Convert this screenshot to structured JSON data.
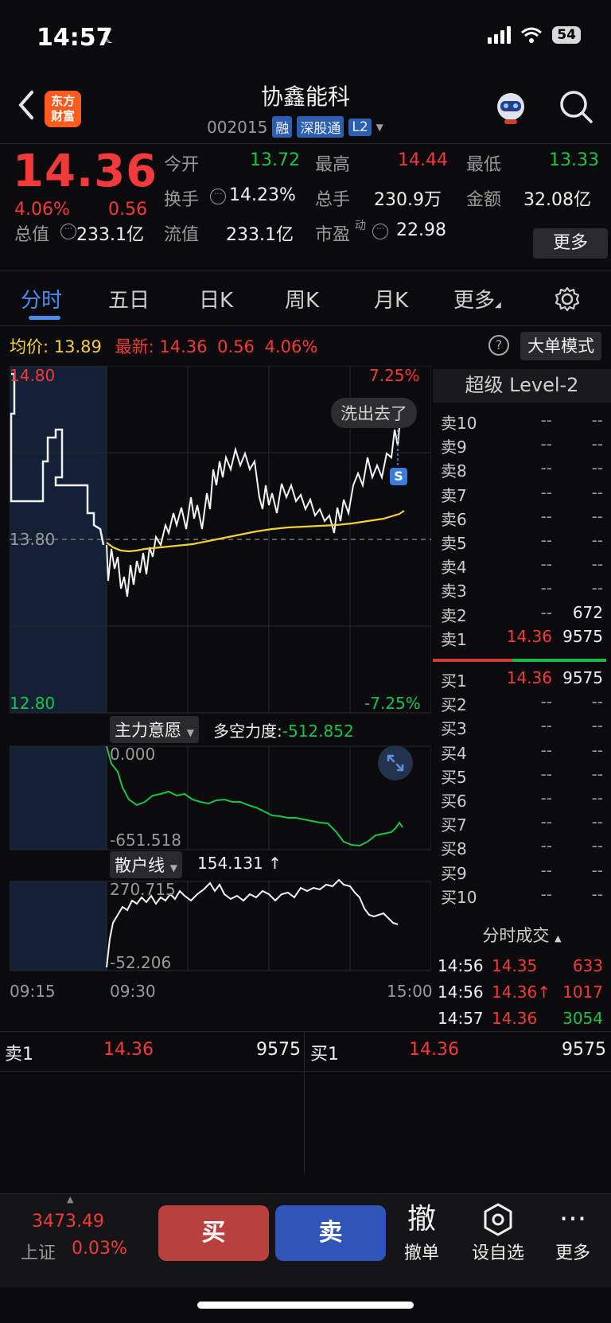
{
  "status": {
    "time": "14:57",
    "battery": "54"
  },
  "header": {
    "brand": [
      "东方",
      "财富"
    ],
    "title": "协鑫能科",
    "code": "002015",
    "tags": [
      "融",
      "深股通",
      "L2"
    ]
  },
  "quote": {
    "price": "14.36",
    "change_pct": "4.06%",
    "change": "0.56",
    "open_label": "今开",
    "open": "13.72",
    "high_label": "最高",
    "high": "14.44",
    "low_label": "最低",
    "low": "13.33",
    "turnover_label": "换手",
    "turnover": "14.23%",
    "volume_label": "总手",
    "volume": "230.9万",
    "amount_label": "金额",
    "amount": "32.08亿",
    "mktcap_label": "总值",
    "mktcap": "233.1亿",
    "float_label": "流值",
    "float": "233.1亿",
    "pe_label": "市盈",
    "pe_sup": "动",
    "pe": "22.98",
    "more": "更多"
  },
  "tabs": [
    "分时",
    "五日",
    "日K",
    "周K",
    "月K",
    "更多"
  ],
  "info": {
    "avg_label": "均价:",
    "avg": "13.89",
    "latest_label": "最新:",
    "latest": "14.36",
    "latest_chg": "0.56",
    "latest_pct": "4.06%",
    "big_mode": "大单模式"
  },
  "chart": {
    "top_price": "14.80",
    "mid_price": "13.80",
    "bottom_price": "12.80",
    "top_pct": "7.25%",
    "bottom_pct": "-7.25%",
    "toast": "洗出去了",
    "marker": "S",
    "ind1_btn": "主力意愿",
    "ind1_name": "多空力度:",
    "ind1_value": "-512.852",
    "ind1_top": "0.000",
    "ind1_bottom": "-651.518",
    "ind2_btn": "散户线",
    "ind2_value": "154.131 ↑",
    "ind2_top": "270.715",
    "ind2_bottom": "-52.206",
    "time_start": "09:15",
    "time_mid": "09:30",
    "time_end": "15:00"
  },
  "orderbook": {
    "title": "超级 Level-2",
    "asks": [
      {
        "label": "卖10",
        "price": "--",
        "vol": "--"
      },
      {
        "label": "卖9",
        "price": "--",
        "vol": "--"
      },
      {
        "label": "卖8",
        "price": "--",
        "vol": "--"
      },
      {
        "label": "卖7",
        "price": "--",
        "vol": "--"
      },
      {
        "label": "卖6",
        "price": "--",
        "vol": "--"
      },
      {
        "label": "卖5",
        "price": "--",
        "vol": "--"
      },
      {
        "label": "卖4",
        "price": "--",
        "vol": "--"
      },
      {
        "label": "卖3",
        "price": "--",
        "vol": "--"
      },
      {
        "label": "卖2",
        "price": "--",
        "vol": "672"
      },
      {
        "label": "卖1",
        "price": "14.36",
        "vol": "9575"
      }
    ],
    "bids": [
      {
        "label": "买1",
        "price": "14.36",
        "vol": "9575"
      },
      {
        "label": "买2",
        "price": "--",
        "vol": "--"
      },
      {
        "label": "买3",
        "price": "--",
        "vol": "--"
      },
      {
        "label": "买4",
        "price": "--",
        "vol": "--"
      },
      {
        "label": "买5",
        "price": "--",
        "vol": "--"
      },
      {
        "label": "买6",
        "price": "--",
        "vol": "--"
      },
      {
        "label": "买7",
        "price": "--",
        "vol": "--"
      },
      {
        "label": "买8",
        "price": "--",
        "vol": "--"
      },
      {
        "label": "买9",
        "price": "--",
        "vol": "--"
      },
      {
        "label": "买10",
        "price": "--",
        "vol": "--"
      }
    ],
    "trades_title": "分时成交",
    "trades": [
      {
        "time": "14:56",
        "price": "14.35",
        "vol": "633"
      },
      {
        "time": "14:56",
        "price": "14.36↑",
        "vol": "1017"
      },
      {
        "time": "14:57",
        "price": "14.36",
        "vol": "3054"
      }
    ]
  },
  "summary": {
    "ask_label": "卖1",
    "ask_price": "14.36",
    "ask_vol": "9575",
    "bid_label": "买1",
    "bid_price": "14.36",
    "bid_vol": "9575"
  },
  "actionbar": {
    "index_value": "3473.49",
    "index_name": "上证",
    "index_pct": "0.03%",
    "buy": "买",
    "sell": "卖",
    "cancel_icon": "撤",
    "cancel": "撤单",
    "watch": "设自选",
    "more": "更多"
  },
  "colors": {
    "up": "#f23a3a",
    "down": "#17c44a",
    "accent": "#4a8ef0",
    "avg_line": "#f2d13b"
  }
}
